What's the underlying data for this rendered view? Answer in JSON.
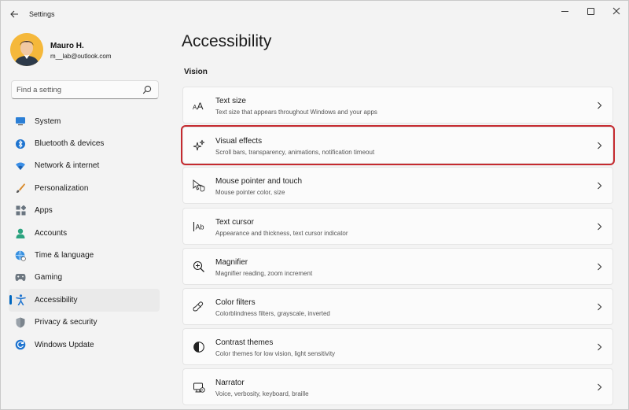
{
  "window": {
    "title": "Settings",
    "back_icon": "back-arrow-icon",
    "controls": [
      "minimize",
      "maximize",
      "close"
    ]
  },
  "user": {
    "name": "Mauro H.",
    "email": "m__lab@outlook.com"
  },
  "search": {
    "placeholder": "Find a setting",
    "value": ""
  },
  "sidebar": {
    "items": [
      {
        "label": "System",
        "icon": "monitor-icon"
      },
      {
        "label": "Bluetooth & devices",
        "icon": "bluetooth-icon"
      },
      {
        "label": "Network & internet",
        "icon": "wifi-icon"
      },
      {
        "label": "Personalization",
        "icon": "brush-icon"
      },
      {
        "label": "Apps",
        "icon": "apps-icon"
      },
      {
        "label": "Accounts",
        "icon": "person-icon"
      },
      {
        "label": "Time & language",
        "icon": "globe-clock-icon"
      },
      {
        "label": "Gaming",
        "icon": "gamepad-icon"
      },
      {
        "label": "Accessibility",
        "icon": "accessibility-icon",
        "selected": true
      },
      {
        "label": "Privacy & security",
        "icon": "shield-icon"
      },
      {
        "label": "Windows Update",
        "icon": "update-icon"
      }
    ]
  },
  "main": {
    "title": "Accessibility",
    "section": "Vision",
    "cards": [
      {
        "title": "Text size",
        "desc": "Text size that appears throughout Windows and your apps",
        "icon": "text-size-icon"
      },
      {
        "title": "Visual effects",
        "desc": "Scroll bars, transparency, animations, notification timeout",
        "icon": "sparkle-icon",
        "highlighted": true
      },
      {
        "title": "Mouse pointer and touch",
        "desc": "Mouse pointer color, size",
        "icon": "mouse-pointer-icon"
      },
      {
        "title": "Text cursor",
        "desc": "Appearance and thickness, text cursor indicator",
        "icon": "text-cursor-icon"
      },
      {
        "title": "Magnifier",
        "desc": "Magnifier reading, zoom increment",
        "icon": "magnifier-icon"
      },
      {
        "title": "Color filters",
        "desc": "Colorblindness filters, grayscale, inverted",
        "icon": "color-filter-icon"
      },
      {
        "title": "Contrast themes",
        "desc": "Color themes for low vision, light sensitivity",
        "icon": "contrast-icon"
      },
      {
        "title": "Narrator",
        "desc": "Voice, verbosity, keyboard, braille",
        "icon": "narrator-icon"
      }
    ]
  },
  "colors": {
    "accent": "#0067c0",
    "highlight_border": "#c52a2f",
    "background": "#f3f3f3",
    "card": "#fbfbfb"
  }
}
